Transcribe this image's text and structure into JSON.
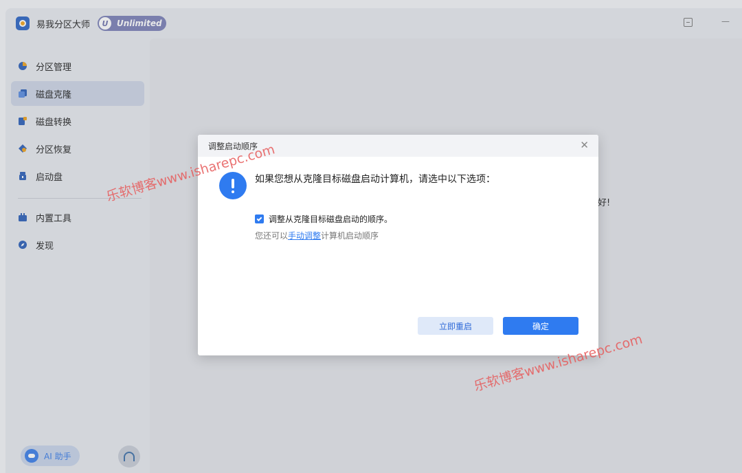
{
  "app": {
    "title": "易我分区大师",
    "badge_letter": "U",
    "badge_text": "Unlimited"
  },
  "sidebar": {
    "items": [
      {
        "label": "分区管理",
        "icon": "pie-chart-icon",
        "active": false
      },
      {
        "label": "磁盘克隆",
        "icon": "copy-disk-icon",
        "active": true
      },
      {
        "label": "磁盘转换",
        "icon": "convert-icon",
        "active": false
      },
      {
        "label": "分区恢复",
        "icon": "recover-icon",
        "active": false
      },
      {
        "label": "启动盘",
        "icon": "usb-icon",
        "active": false
      },
      {
        "label": "内置工具",
        "icon": "toolbox-icon",
        "active": false
      },
      {
        "label": "发现",
        "icon": "compass-icon",
        "active": false
      }
    ],
    "ai_label": "AI 助手"
  },
  "main": {
    "hint_text": "好!"
  },
  "dialog": {
    "title": "调整启动顺序",
    "question": "如果您想从克隆目标磁盘启动计算机，请选中以下选项：",
    "checkbox_label": "调整从克隆目标磁盘启动的顺序。",
    "checkbox_checked": true,
    "sub_prefix": "您还可以",
    "sub_link": "手动调整",
    "sub_suffix": "计算机启动顺序",
    "btn_restart": "立即重启",
    "btn_ok": "确定"
  },
  "watermark": {
    "text1": "乐软博客www.isharepc.com",
    "text2": "乐软博客www.isharepc.com"
  },
  "colors": {
    "accent": "#2f7bf0",
    "sidebar_active": "#cdd5e6",
    "watermark": "#e65a5a"
  }
}
